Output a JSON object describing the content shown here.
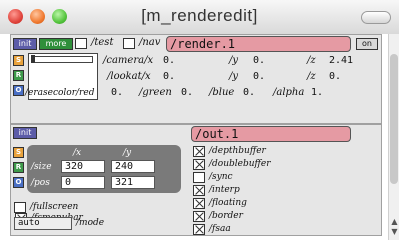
{
  "window": {
    "title": "[m_renderedit]"
  },
  "top_panel": {
    "init_label": "init",
    "more_label": "more",
    "test_label": "/test",
    "nav_label": "/nav",
    "render_message": "/render.1",
    "on_label": "on",
    "side_buttons": [
      "S",
      "R",
      "O"
    ],
    "camera_x_label": "/camera/x",
    "camera_x": "0.",
    "camera_y_label": "/y",
    "camera_y": "0.",
    "camera_z_label": "/z",
    "camera_z": "2.41",
    "lookat_x_label": "/lookat/x",
    "lookat_x": "0.",
    "lookat_y_label": "/y",
    "lookat_y": "0.",
    "lookat_z_label": "/z",
    "lookat_z": "0.",
    "erase_label": "/erasecolor/red",
    "erase_red": "0.",
    "green_label": "/green",
    "green": "0.",
    "blue_label": "/blue",
    "blue": "0.",
    "alpha_label": "/alpha",
    "alpha": "1."
  },
  "bottom_panel": {
    "init_label": "init",
    "out_message": "/out.1",
    "side_buttons": [
      "S",
      "R",
      "O"
    ],
    "x_col_label": "/x",
    "y_col_label": "/y",
    "size_label": "/size",
    "size_x": "320",
    "size_y": "240",
    "pos_label": "/pos",
    "pos_x": "0",
    "pos_y": "321",
    "toggles": [
      {
        "label": "/depthbuffer",
        "on": true
      },
      {
        "label": "/doublebuffer",
        "on": true
      },
      {
        "label": "/sync",
        "on": false
      },
      {
        "label": "/interp",
        "on": true
      },
      {
        "label": "/floating",
        "on": true
      },
      {
        "label": "/border",
        "on": true
      },
      {
        "label": "/fsaa",
        "on": true
      }
    ],
    "fsmenubar_label": "/fsmenubar",
    "fsmenubar_on": true,
    "fullscreen_label": "/fullscreen",
    "fullscreen_on": false,
    "mode_value": "auto",
    "mode_label": "/mode"
  },
  "colors": {
    "init_button": "#5c5ca8",
    "more_button": "#2f8f3a",
    "s_button": "#e8a23c",
    "r_button": "#3e9a4a",
    "o_button": "#4a6fc4",
    "message_pink": "#e59aa3",
    "dark_panel": "#7a7a7a"
  }
}
